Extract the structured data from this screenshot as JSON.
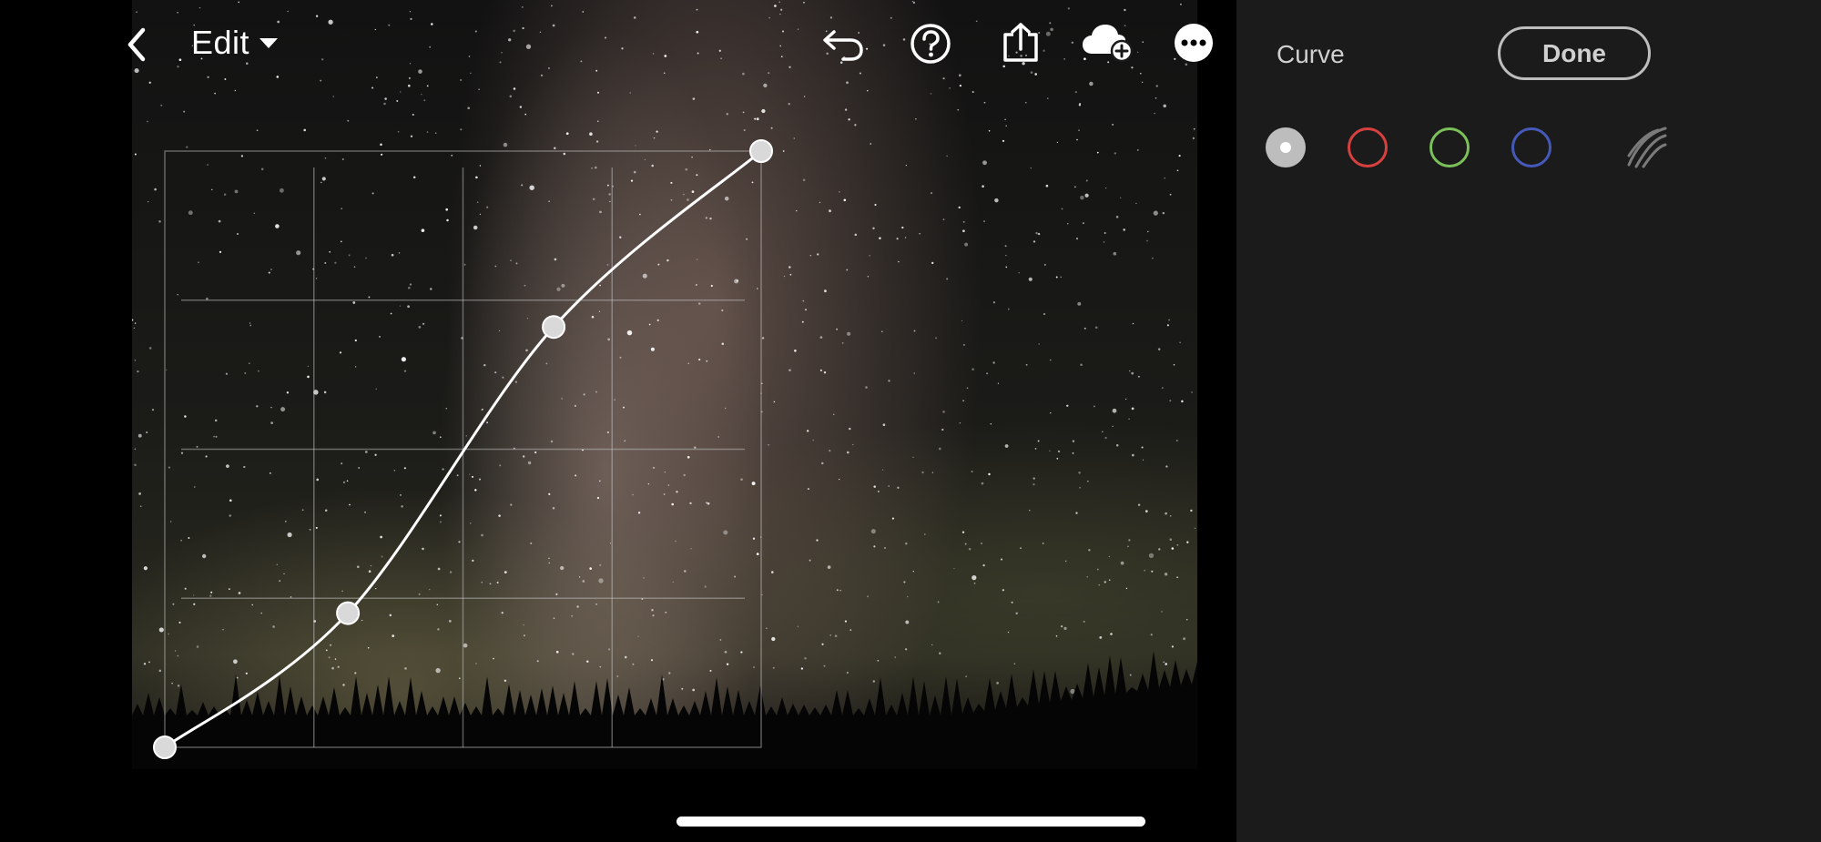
{
  "topbar": {
    "edit_label": "Edit",
    "icons": [
      "back-chevron-icon",
      "dropdown-caret-icon",
      "undo-icon",
      "help-icon",
      "share-icon",
      "cloud-add-icon",
      "more-icon"
    ]
  },
  "panel": {
    "title": "Curve",
    "done_label": "Done",
    "channels": [
      {
        "name": "rgb",
        "color": "#bdbdbd",
        "selected": true
      },
      {
        "name": "red",
        "color": "#d6413f",
        "selected": false
      },
      {
        "name": "green",
        "color": "#7cc05a",
        "selected": false
      },
      {
        "name": "blue",
        "color": "#4559b8",
        "selected": false
      }
    ],
    "parametric_icon": "parametric-curve-icon"
  },
  "curve": {
    "points": [
      [
        0.0,
        0.0
      ],
      [
        0.307,
        0.225
      ],
      [
        0.652,
        0.705
      ],
      [
        1.0,
        1.0
      ]
    ],
    "grid_divisions": 4
  },
  "colors": {
    "panel_bg": "#1b1b1b",
    "curve_line": "#ffffff",
    "grid_line": "rgba(200,200,200,0.45)"
  }
}
